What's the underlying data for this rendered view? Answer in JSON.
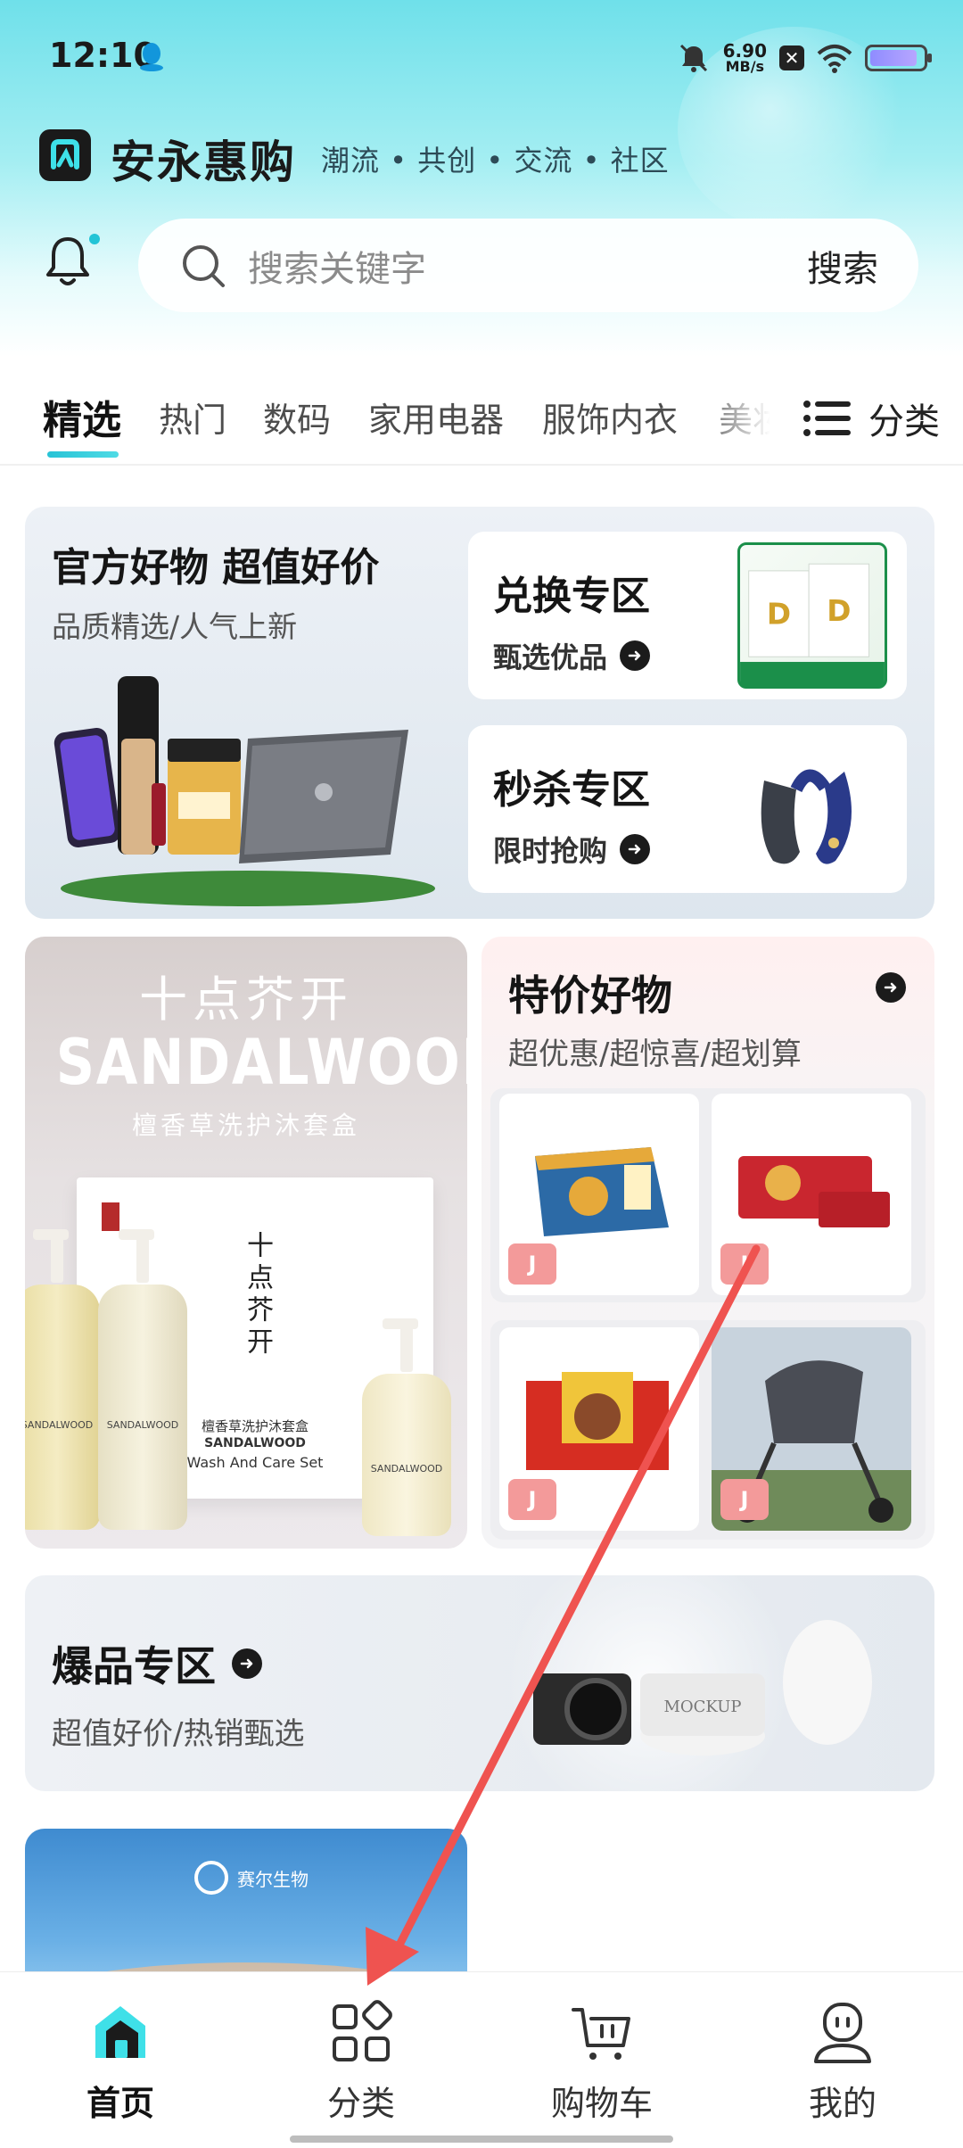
{
  "status_bar": {
    "time": "12:10",
    "net_speed_value": "6.90",
    "net_speed_unit": "MB/s",
    "badge": "✕"
  },
  "app": {
    "title": "安永惠购",
    "slogan": "潮流 • 共创 • 交流 • 社区"
  },
  "search": {
    "placeholder": "搜索关键字",
    "button": "搜索"
  },
  "tabs": {
    "items": [
      "精选",
      "热门",
      "数码",
      "家用电器",
      "服饰内衣",
      "美妆"
    ],
    "more_label": "分类"
  },
  "banner_official": {
    "title": "官方好物 超值好价",
    "subtitle": "品质精选/人气上新",
    "exchange": {
      "title": "兑换专区",
      "link": "甄选优品"
    },
    "flash": {
      "title": "秒杀专区",
      "link": "限时抢购"
    }
  },
  "sandalwood": {
    "brand_cn": "十点芥开",
    "brand_en": "SANDALWOOD",
    "desc": "檀香草洗护沐套盒",
    "box_text_1": "檀香草洗护沐套盒",
    "box_text_2": "SANDALWOOD",
    "box_text_3": "Wash And Care Set",
    "bottle_label": "SANDALWOOD"
  },
  "special": {
    "title": "特价好物",
    "subtitle": "超优惠/超惊喜/超划算",
    "badge": "J"
  },
  "hot": {
    "title": "爆品专区",
    "subtitle": "超值好价/热销甄选",
    "mockup_text": "MOCKUP"
  },
  "partial_banner": {
    "brand": "赛尔生物"
  },
  "bottom_nav": {
    "home": "首页",
    "category": "分类",
    "cart": "购物车",
    "me": "我的"
  },
  "colors": {
    "accent": "#27c3d6",
    "header_top": "#6fe0ea",
    "annotation_arrow": "#ef5350"
  }
}
